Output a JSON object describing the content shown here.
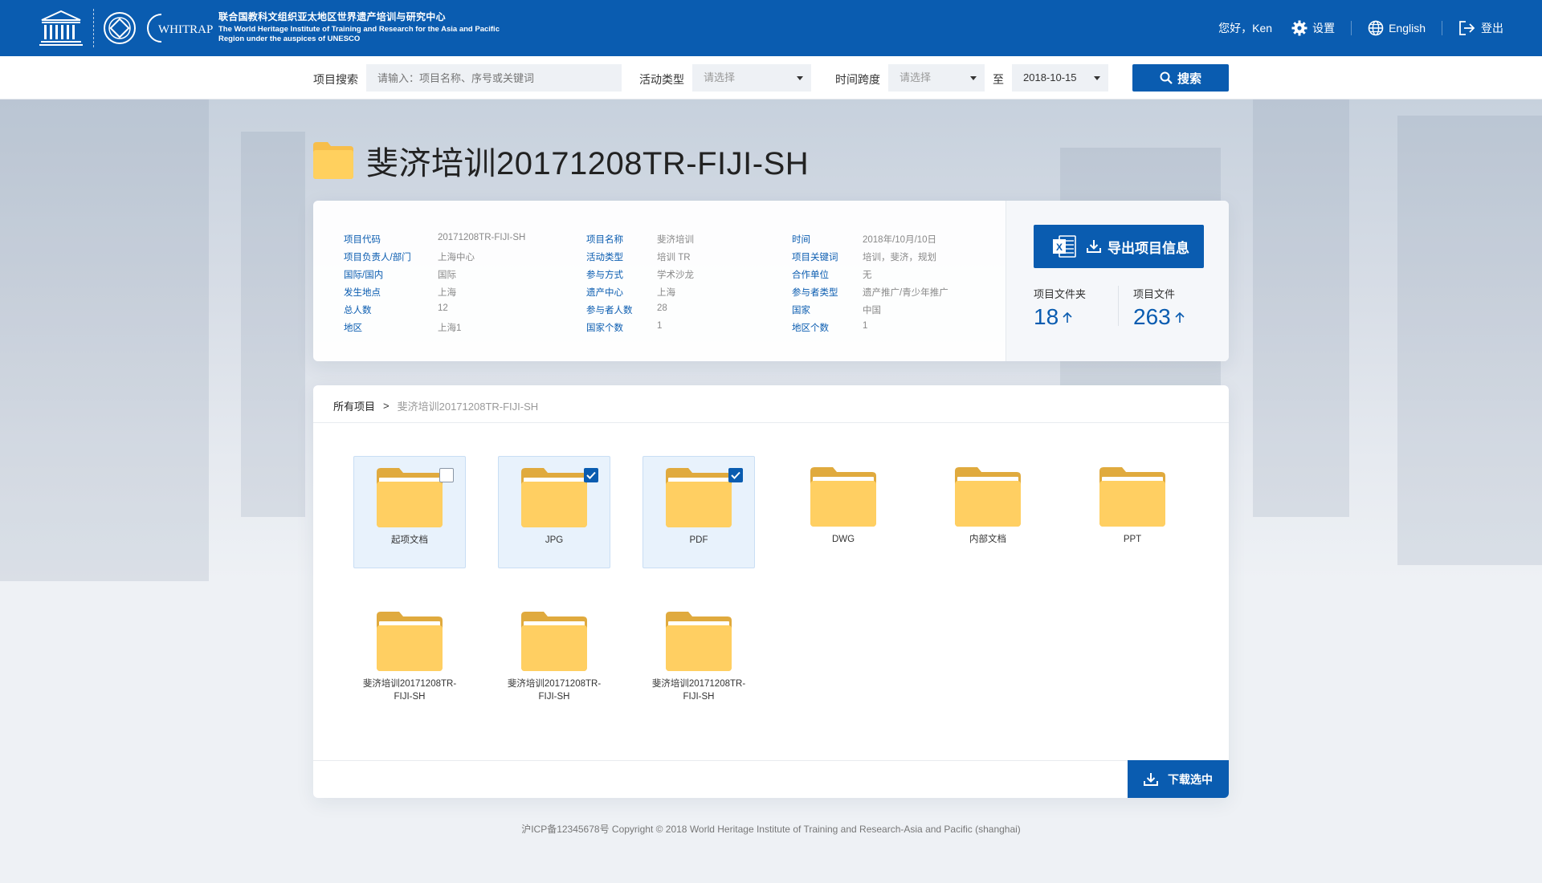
{
  "header": {
    "org_cn": "联合国教科文组织亚太地区世界遗产培训与研究中心",
    "org_en": "The World Heritage Institute of Training and Research for the Asia and Pacific Region under the auspices of UNESCO",
    "logo_unesco_text": "UNESCO",
    "logo_whitrap_text": "WHITRAP",
    "greeting": "您好，Ken",
    "settings": "设置",
    "language": "English",
    "logout": "登出",
    "brand_color": "#0a5cb0"
  },
  "search": {
    "project_label": "项目搜索",
    "project_placeholder": "请输入：项目名称、序号或关键词",
    "activity_label": "活动类型",
    "activity_value": "请选择",
    "time_label": "时间跨度",
    "time_value": "请选择",
    "to_label": "至",
    "date_value": "2018-10-15",
    "search_button": "搜索"
  },
  "project": {
    "title": "斐济培训20171208TR-FIJI-SH",
    "fields": [
      {
        "k": "项目代码",
        "v": "20171208TR-FIJI-SH"
      },
      {
        "k": "项目负责人/部门",
        "v": "上海中心"
      },
      {
        "k": "国际/国内",
        "v": "国际"
      },
      {
        "k": "发生地点",
        "v": "上海"
      },
      {
        "k": "总人数",
        "v": "12"
      },
      {
        "k": "地区",
        "v": "上海1"
      },
      {
        "k": "项目名称",
        "v": "斐济培训"
      },
      {
        "k": "活动类型",
        "v": "培训  TR"
      },
      {
        "k": "参与方式",
        "v": "学术沙龙"
      },
      {
        "k": "遗产中心",
        "v": "上海"
      },
      {
        "k": "参与者人数",
        "v": "28"
      },
      {
        "k": "国家个数",
        "v": "1"
      },
      {
        "k": "时间",
        "v": "2018年/10月/10日"
      },
      {
        "k": "项目关键词",
        "v": "培训，斐济，规划"
      },
      {
        "k": "合作单位",
        "v": "无"
      },
      {
        "k": "参与者类型",
        "v": "遗产推广/青少年推广"
      },
      {
        "k": "国家",
        "v": "中国"
      },
      {
        "k": "地区个数",
        "v": "1"
      }
    ],
    "export_button": "导出项目信息",
    "folders_label": "项目文件夹",
    "folders_count": "18",
    "files_label": "项目文件",
    "files_count": "263"
  },
  "files": {
    "breadcrumb_root": "所有项目",
    "breadcrumb_sep": ">",
    "breadcrumb_current": "斐济培训20171208TR-FIJI-SH",
    "folders": [
      {
        "name": "起项文档",
        "selected": true,
        "checked": false
      },
      {
        "name": "JPG",
        "selected": true,
        "checked": true
      },
      {
        "name": "PDF",
        "selected": true,
        "checked": true
      },
      {
        "name": "DWG",
        "selected": false,
        "checked": false
      },
      {
        "name": "内部文档",
        "selected": false,
        "checked": false
      },
      {
        "name": "PPT",
        "selected": false,
        "checked": false
      },
      {
        "name": "斐济培训20171208TR-FIJI-SH",
        "selected": false,
        "checked": false
      },
      {
        "name": "斐济培训20171208TR-FIJI-SH",
        "selected": false,
        "checked": false
      },
      {
        "name": "斐济培训20171208TR-FIJI-SH",
        "selected": false,
        "checked": false
      }
    ],
    "download_button": "下载选中"
  },
  "footer": {
    "text": "沪ICP备12345678号 Copyright © 2018 World Heritage Institute of Training and Research-Asia and Pacific (shanghai)"
  }
}
